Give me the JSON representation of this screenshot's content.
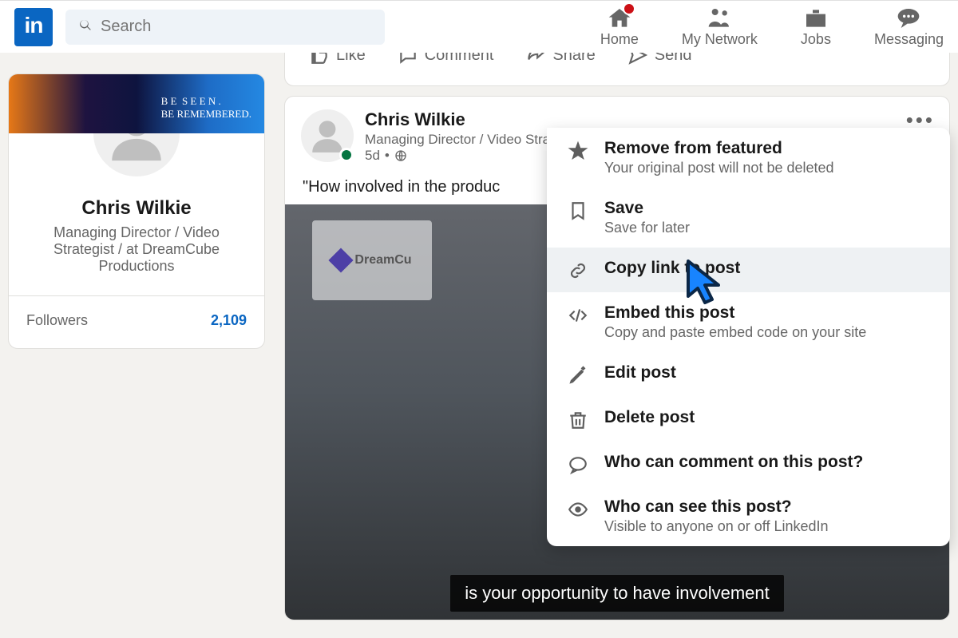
{
  "header": {
    "search_placeholder": "Search",
    "nav": {
      "home": "Home",
      "network": "My Network",
      "jobs": "Jobs",
      "messaging": "Messaging"
    }
  },
  "sidebar": {
    "cover_text": "B E  S E E N .\nBE REMEMBERED.",
    "name": "Chris Wilkie",
    "headline": "Managing Director / Video Strategist / at DreamCube Productions",
    "followers_label": "Followers",
    "followers_count": "2,109"
  },
  "prev_actions": [
    "Like",
    "Comment",
    "Share",
    "Send"
  ],
  "post": {
    "author": "Chris Wilkie",
    "role": "Managing Director / Video Strategist / at DreamCube Productions",
    "time": "5d",
    "sep": " • ",
    "body": "\"How involved in the produc",
    "caption": "is your opportunity to have involvement",
    "sign": "DreamCu"
  },
  "menu": [
    {
      "title": "Remove from featured",
      "sub": "Your original post will not be deleted"
    },
    {
      "title": "Save",
      "sub": "Save for later"
    },
    {
      "title": "Copy link to post",
      "sub": ""
    },
    {
      "title": "Embed this post",
      "sub": "Copy and paste embed code on your site"
    },
    {
      "title": "Edit post",
      "sub": ""
    },
    {
      "title": "Delete post",
      "sub": ""
    },
    {
      "title": "Who can comment on this post?",
      "sub": ""
    },
    {
      "title": "Who can see this post?",
      "sub": "Visible to anyone on or off LinkedIn"
    }
  ]
}
